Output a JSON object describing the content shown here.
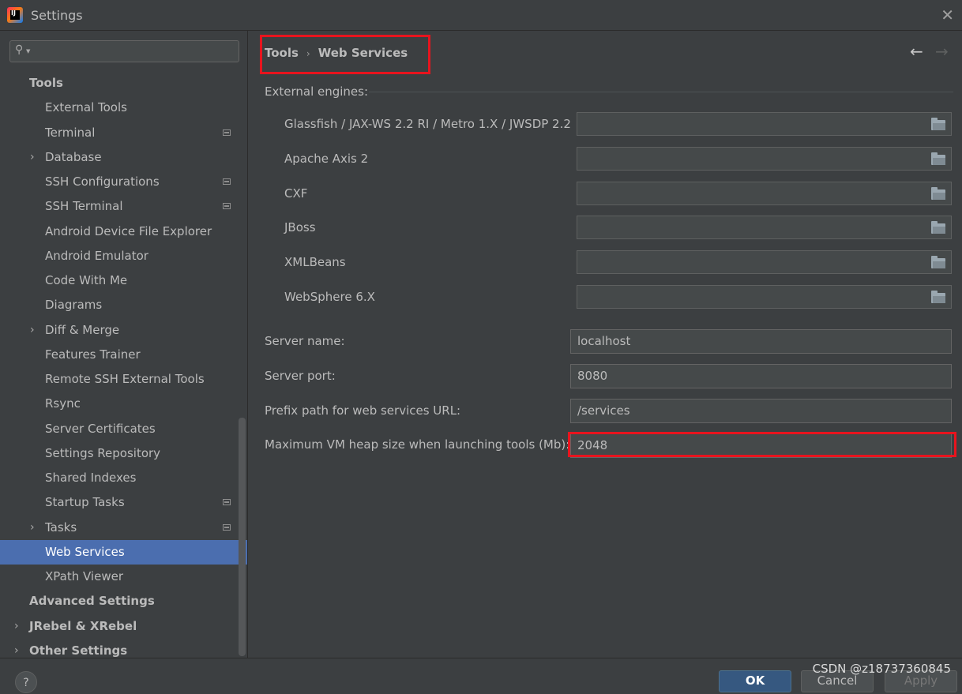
{
  "window": {
    "title": "Settings",
    "close_glyph": "✕",
    "app_icon_text": "IJ"
  },
  "sidebar": {
    "search_placeholder": "",
    "items": [
      {
        "label": "Tools",
        "bold": true,
        "expandable": false,
        "project_icon": false
      },
      {
        "label": "External Tools",
        "expandable": false,
        "project_icon": false
      },
      {
        "label": "Terminal",
        "expandable": false,
        "project_icon": true
      },
      {
        "label": "Database",
        "expandable": true,
        "project_icon": false
      },
      {
        "label": "SSH Configurations",
        "expandable": false,
        "project_icon": true
      },
      {
        "label": "SSH Terminal",
        "expandable": false,
        "project_icon": true
      },
      {
        "label": "Android Device File Explorer",
        "expandable": false,
        "project_icon": false
      },
      {
        "label": "Android Emulator",
        "expandable": false,
        "project_icon": false
      },
      {
        "label": "Code With Me",
        "expandable": false,
        "project_icon": false
      },
      {
        "label": "Diagrams",
        "expandable": false,
        "project_icon": false
      },
      {
        "label": "Diff & Merge",
        "expandable": true,
        "project_icon": false
      },
      {
        "label": "Features Trainer",
        "expandable": false,
        "project_icon": false
      },
      {
        "label": "Remote SSH External Tools",
        "expandable": false,
        "project_icon": false
      },
      {
        "label": "Rsync",
        "expandable": false,
        "project_icon": false
      },
      {
        "label": "Server Certificates",
        "expandable": false,
        "project_icon": false
      },
      {
        "label": "Settings Repository",
        "expandable": false,
        "project_icon": false
      },
      {
        "label": "Shared Indexes",
        "expandable": false,
        "project_icon": false
      },
      {
        "label": "Startup Tasks",
        "expandable": false,
        "project_icon": true
      },
      {
        "label": "Tasks",
        "expandable": true,
        "project_icon": true
      },
      {
        "label": "Web Services",
        "expandable": false,
        "project_icon": false,
        "selected": true
      },
      {
        "label": "XPath Viewer",
        "expandable": false,
        "project_icon": false
      },
      {
        "label": "Advanced Settings",
        "bold": true,
        "expandable": false,
        "project_icon": false
      },
      {
        "label": "JRebel & XRebel",
        "bold": true,
        "expandable": true,
        "project_icon": false
      },
      {
        "label": "Other Settings",
        "bold": true,
        "expandable": true,
        "project_icon": false
      }
    ]
  },
  "breadcrumb": {
    "parent": "Tools",
    "separator": "›",
    "current": "Web Services",
    "back_glyph": "←",
    "forward_glyph": "→"
  },
  "engines": {
    "section_label": "External engines:",
    "items": [
      {
        "label": "Glassfish / JAX-WS 2.2 RI / Metro 1.X / JWSDP 2.2",
        "value": ""
      },
      {
        "label": "Apache Axis 2",
        "value": ""
      },
      {
        "label": "CXF",
        "value": ""
      },
      {
        "label": "JBoss",
        "value": ""
      },
      {
        "label": "XMLBeans",
        "value": ""
      },
      {
        "label": "WebSphere 6.X",
        "value": ""
      }
    ]
  },
  "server": {
    "name_label": "Server name:",
    "name_value": "localhost",
    "port_label": "Server port:",
    "port_value": "8080",
    "prefix_label": "Prefix path for web services URL:",
    "prefix_value": "/services",
    "heap_label": "Maximum VM heap size when launching tools (Mb):",
    "heap_value": "2048"
  },
  "footer": {
    "help": "?",
    "ok": "OK",
    "cancel": "Cancel",
    "apply": "Apply",
    "watermark": "CSDN @z18737360845"
  },
  "colors": {
    "highlight": "#e8141e",
    "selection": "#4b6eaf"
  }
}
